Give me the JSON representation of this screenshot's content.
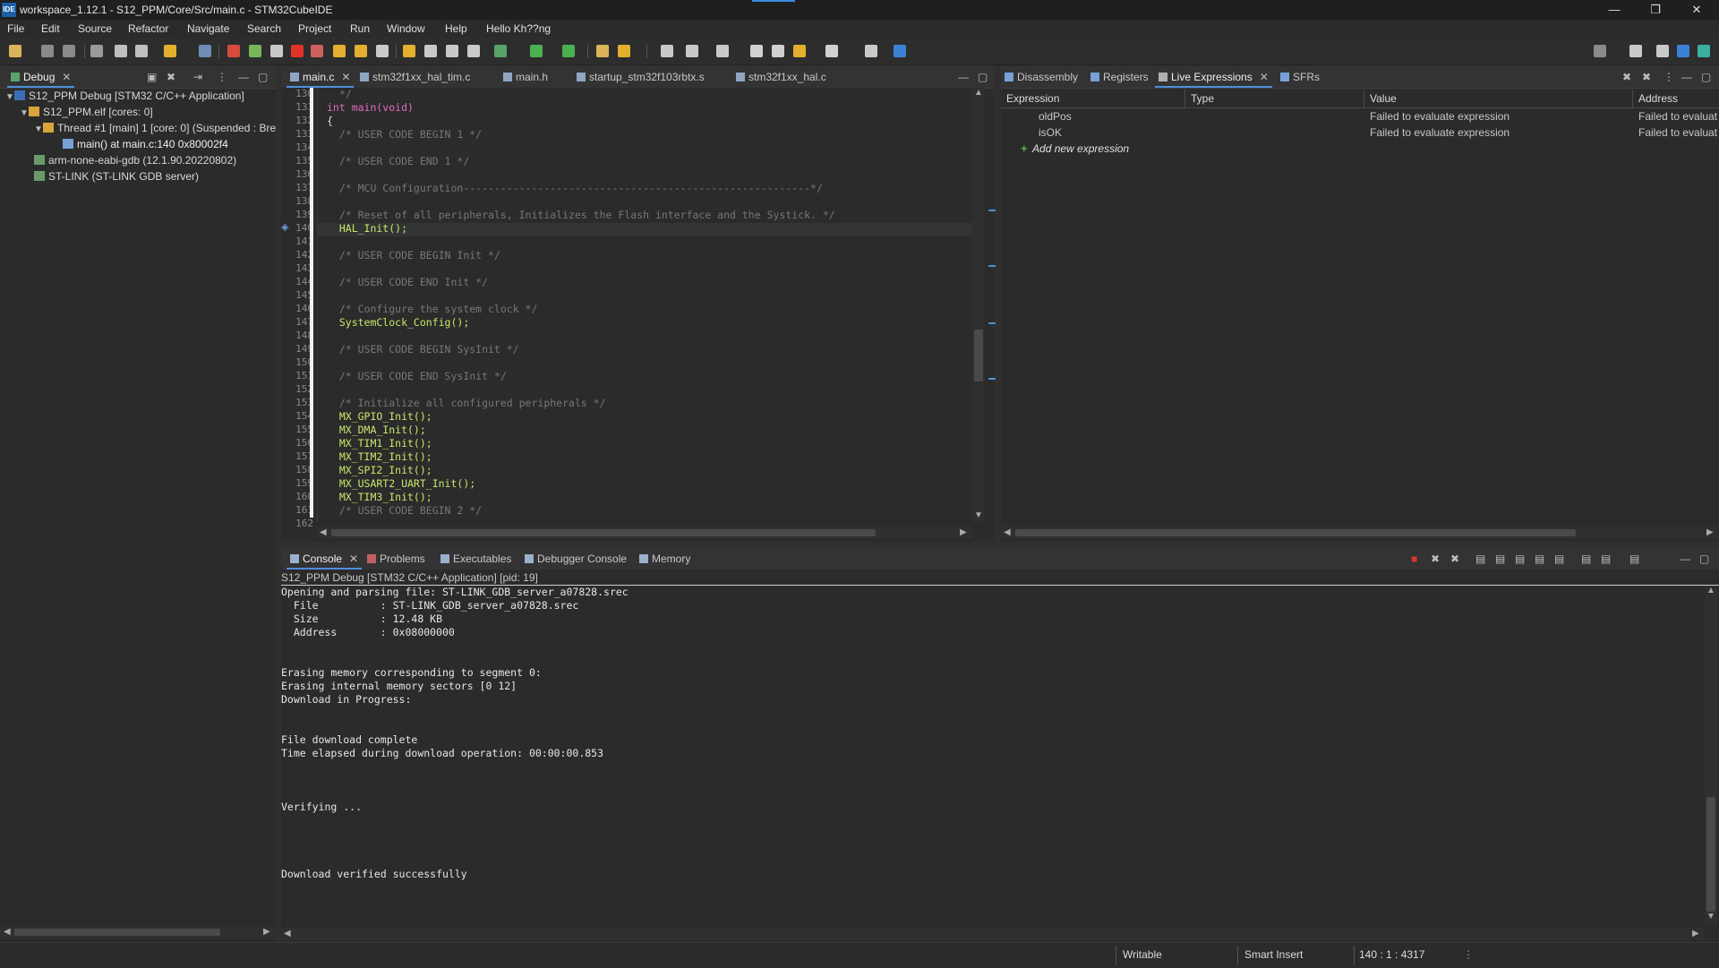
{
  "window": {
    "title": "workspace_1.12.1 - S12_PPM/Core/Src/main.c - STM32CubeIDE",
    "app_icon": "IDE",
    "min": "—",
    "max": "❐",
    "close": "✕"
  },
  "menu": [
    "File",
    "Edit",
    "Source",
    "Refactor",
    "Navigate",
    "Search",
    "Project",
    "Run",
    "Window",
    "Help",
    "Hello Kh??ng"
  ],
  "debug_view": {
    "tab": "Debug",
    "tree": [
      {
        "label": "S12_PPM Debug [STM32 C/C++ Application]"
      },
      {
        "label": "S12_PPM.elf [cores: 0]"
      },
      {
        "label": "Thread #1 [main] 1 [core: 0] (Suspended : Bre"
      },
      {
        "label": "main() at main.c:140 0x80002f4"
      },
      {
        "label": "arm-none-eabi-gdb (12.1.90.20220802)"
      },
      {
        "label": "ST-LINK (ST-LINK GDB server)"
      }
    ]
  },
  "editor": {
    "tabs": [
      "main.c",
      "stm32f1xx_hal_tim.c",
      "main.h",
      "startup_stm32f103rbtx.s",
      "stm32f1xx_hal.c"
    ],
    "lines": [
      {
        "n": "130",
        "t": "  */"
      },
      {
        "n": "131",
        "t": "int main(void)"
      },
      {
        "n": "132",
        "t": "{"
      },
      {
        "n": "133",
        "t": "  /* USER CODE BEGIN 1 */"
      },
      {
        "n": "134",
        "t": ""
      },
      {
        "n": "135",
        "t": "  /* USER CODE END 1 */"
      },
      {
        "n": "136",
        "t": ""
      },
      {
        "n": "137",
        "t": "  /* MCU Configuration--------------------------------------------------------*/"
      },
      {
        "n": "138",
        "t": ""
      },
      {
        "n": "139",
        "t": "  /* Reset of all peripherals, Initializes the Flash interface and the Systick. */"
      },
      {
        "n": "140",
        "t": "  HAL_Init();"
      },
      {
        "n": "141",
        "t": ""
      },
      {
        "n": "142",
        "t": "  /* USER CODE BEGIN Init */"
      },
      {
        "n": "143",
        "t": ""
      },
      {
        "n": "144",
        "t": "  /* USER CODE END Init */"
      },
      {
        "n": "145",
        "t": ""
      },
      {
        "n": "146",
        "t": "  /* Configure the system clock */"
      },
      {
        "n": "147",
        "t": "  SystemClock_Config();"
      },
      {
        "n": "148",
        "t": ""
      },
      {
        "n": "149",
        "t": "  /* USER CODE BEGIN SysInit */"
      },
      {
        "n": "150",
        "t": ""
      },
      {
        "n": "151",
        "t": "  /* USER CODE END SysInit */"
      },
      {
        "n": "152",
        "t": ""
      },
      {
        "n": "153",
        "t": "  /* Initialize all configured peripherals */"
      },
      {
        "n": "154",
        "t": "  MX_GPIO_Init();"
      },
      {
        "n": "155",
        "t": "  MX_DMA_Init();"
      },
      {
        "n": "156",
        "t": "  MX_TIM1_Init();"
      },
      {
        "n": "157",
        "t": "  MX_TIM2_Init();"
      },
      {
        "n": "158",
        "t": "  MX_SPI2_Init();"
      },
      {
        "n": "159",
        "t": "  MX_USART2_UART_Init();"
      },
      {
        "n": "160",
        "t": "  MX_TIM3_Init();"
      },
      {
        "n": "161",
        "t": "  /* USER CODE BEGIN 2 */"
      },
      {
        "n": "162",
        "t": ""
      }
    ]
  },
  "expressions": {
    "tabs": [
      "Disassembly",
      "Registers",
      "Live Expressions",
      "SFRs"
    ],
    "columns": [
      "Expression",
      "Type",
      "Value",
      "Address"
    ],
    "rows": [
      {
        "expr": "oldPos",
        "type": "",
        "value": "Failed to evaluate expression",
        "address": "Failed to evaluat"
      },
      {
        "expr": "isOK",
        "type": "",
        "value": "Failed to evaluate expression",
        "address": "Failed to evaluat"
      }
    ],
    "add": "Add new expression"
  },
  "console": {
    "tabs": [
      "Console",
      "Problems",
      "Executables",
      "Debugger Console",
      "Memory"
    ],
    "header": "S12_PPM Debug [STM32 C/C++ Application]  [pid: 19]",
    "lines": [
      "Opening and parsing file: ST-LINK_GDB_server_a07828.srec",
      "  File          : ST-LINK_GDB_server_a07828.srec",
      "  Size          : 12.48 KB",
      "  Address       : 0x08000000",
      "",
      "",
      "Erasing memory corresponding to segment 0:",
      "Erasing internal memory sectors [0 12]",
      "Download in Progress:",
      "",
      "",
      "File download complete",
      "Time elapsed during download operation: 00:00:00.853",
      "",
      "",
      "",
      "Verifying ...",
      "",
      "",
      "",
      "",
      "Download verified successfully"
    ]
  },
  "status": {
    "mode": "Writable",
    "insert": "Smart Insert",
    "position": "140 : 1 : 4317"
  }
}
